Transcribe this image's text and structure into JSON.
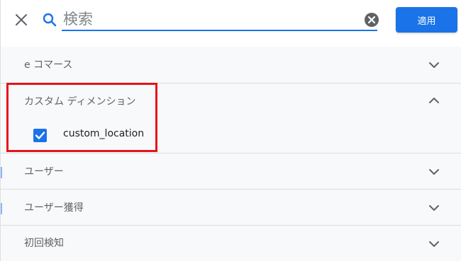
{
  "header": {
    "search_placeholder": "検索",
    "apply_label": "適用"
  },
  "sections": {
    "ecommerce": {
      "label": "e コマース",
      "expanded": false
    },
    "custom_dimensions": {
      "label": "カスタム ディメンション",
      "expanded": true,
      "items": [
        {
          "label": "custom_location",
          "checked": true
        }
      ]
    },
    "user": {
      "label": "ユーザー",
      "expanded": false
    },
    "user_acquisition": {
      "label": "ユーザー獲得",
      "expanded": false
    },
    "first_detection": {
      "label": "初回検知",
      "expanded": false
    }
  },
  "colors": {
    "accent": "#1a73e8",
    "highlight": "#e8131a"
  }
}
